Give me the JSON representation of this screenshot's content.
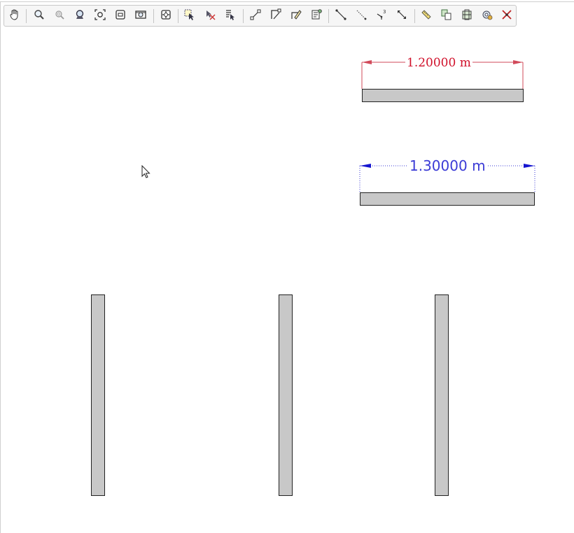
{
  "toolbar": {
    "tools": [
      {
        "name": "pan-icon"
      },
      {
        "name": "zoom-in-icon"
      },
      {
        "name": "zoom-out-icon"
      },
      {
        "name": "zoom-full-icon"
      },
      {
        "name": "zoom-to-layer-icon"
      },
      {
        "name": "zoom-to-selection-icon"
      },
      {
        "name": "zoom-last-icon"
      },
      {
        "name": "pan-to-selection-icon"
      },
      {
        "name": "select-feature-icon"
      },
      {
        "name": "deselect-icon"
      },
      {
        "name": "select-by-expression-icon"
      },
      {
        "name": "add-dimension-icon"
      },
      {
        "name": "move-dimension-icon"
      },
      {
        "name": "edit-dimension-icon"
      },
      {
        "name": "dimension-properties-icon"
      },
      {
        "name": "line-snap-icon"
      },
      {
        "name": "dotted-line-icon"
      },
      {
        "name": "vertex-tool-icon"
      },
      {
        "name": "measure-line-icon"
      },
      {
        "name": "ruler-icon"
      },
      {
        "name": "copy-feature-icon"
      },
      {
        "name": "layer-tool-icon"
      },
      {
        "name": "settings-icon"
      },
      {
        "name": "delete-icon"
      }
    ]
  },
  "dimensions": {
    "red_label": "1.20000 m",
    "blue_label": "1.30000 m",
    "red_color": "#d0102a",
    "blue_color": "#3b3bd6"
  }
}
